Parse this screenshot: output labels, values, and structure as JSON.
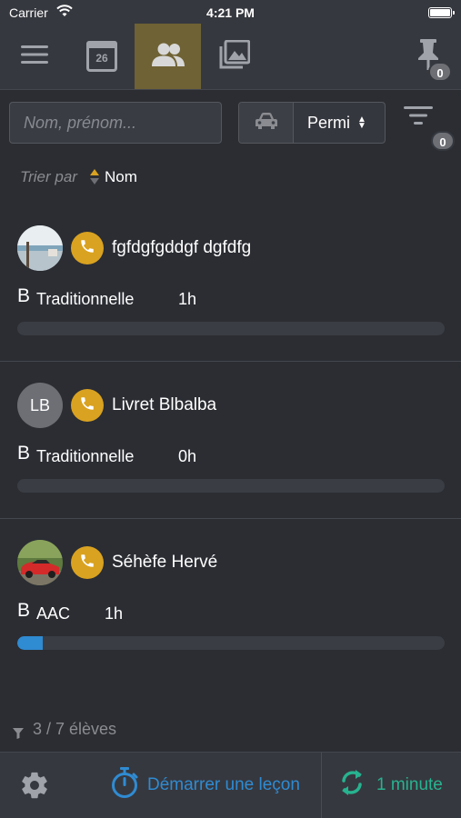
{
  "status_bar": {
    "carrier": "Carrier",
    "time": "4:21 PM"
  },
  "navbar": {
    "tabs": [
      {
        "icon": "menu-icon",
        "active": false
      },
      {
        "icon": "calendar-icon",
        "label": "26",
        "active": false
      },
      {
        "icon": "students-icon",
        "active": true
      },
      {
        "icon": "gallery-icon",
        "active": false
      }
    ],
    "pin_badge": "0"
  },
  "search": {
    "placeholder": "Nom, prénom...",
    "value": ""
  },
  "vehicle_filter": {
    "icon": "car-icon",
    "selected": "Permi"
  },
  "filter": {
    "badge": "0"
  },
  "sort": {
    "label": "Trier par",
    "value": "Nom"
  },
  "students": [
    {
      "name": "fgfdgfgddgf dgfdfg",
      "avatar": "photo",
      "license": "B",
      "formation": "Traditionnelle",
      "hours": "1h",
      "progress": 0
    },
    {
      "name": "Livret Blbalba",
      "avatar": "initials",
      "initials": "LB",
      "license": "B",
      "formation": "Traditionnelle",
      "hours": "0h",
      "progress": 0
    },
    {
      "name": "Séhèfe Hervé",
      "avatar": "photo",
      "license": "B",
      "formation": "AAC",
      "hours": "1h",
      "progress": 0.06
    }
  ],
  "count": "3 / 7 élèves",
  "bottom_bar": {
    "start_label": "Démarrer une leçon",
    "refresh_label": "1 minute"
  },
  "colors": {
    "accent": "#d9a220",
    "active_tab": "#6f6234",
    "start": "#2f8bd2",
    "refresh": "#27b38f"
  }
}
